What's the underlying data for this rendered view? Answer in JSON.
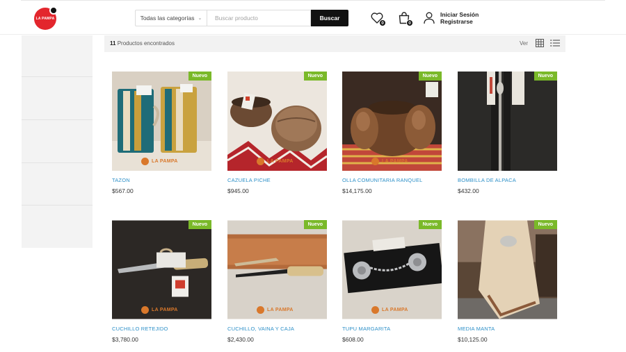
{
  "header": {
    "logo_text": "LA PAMPA",
    "category_select": "Todas las categorías",
    "search_placeholder": "Buscar producto",
    "search_button": "Buscar",
    "wishlist_count": "0",
    "cart_count": "0",
    "login_label": "Iniciar Sesión",
    "register_label": "Registrarse"
  },
  "toolbar": {
    "count": "11",
    "count_suffix": "Productos encontrados",
    "view_label": "Ver"
  },
  "badge_label": "Nuevo",
  "watermark": "LA PAMPA",
  "colors": {
    "badge": "#7ab929",
    "link": "#2e90c8",
    "search_button": "#111111",
    "logo": "#e3262d"
  },
  "products": [
    {
      "name": "TAZON",
      "price": "$567.00"
    },
    {
      "name": "CAZUELA PICHE",
      "price": "$945.00"
    },
    {
      "name": "OLLA COMUNITARIA RANQUEL",
      "price": "$14,175.00"
    },
    {
      "name": "BOMBILLA DE ALPACA",
      "price": "$432.00"
    },
    {
      "name": "CUCHILLO RETEJIDO",
      "price": "$3,780.00"
    },
    {
      "name": "CUCHILLO, VAINA Y CAJA",
      "price": "$2,430.00"
    },
    {
      "name": "TUPU MARGARITA",
      "price": "$608.00"
    },
    {
      "name": "MEDIA MANTA",
      "price": "$10,125.00"
    }
  ]
}
